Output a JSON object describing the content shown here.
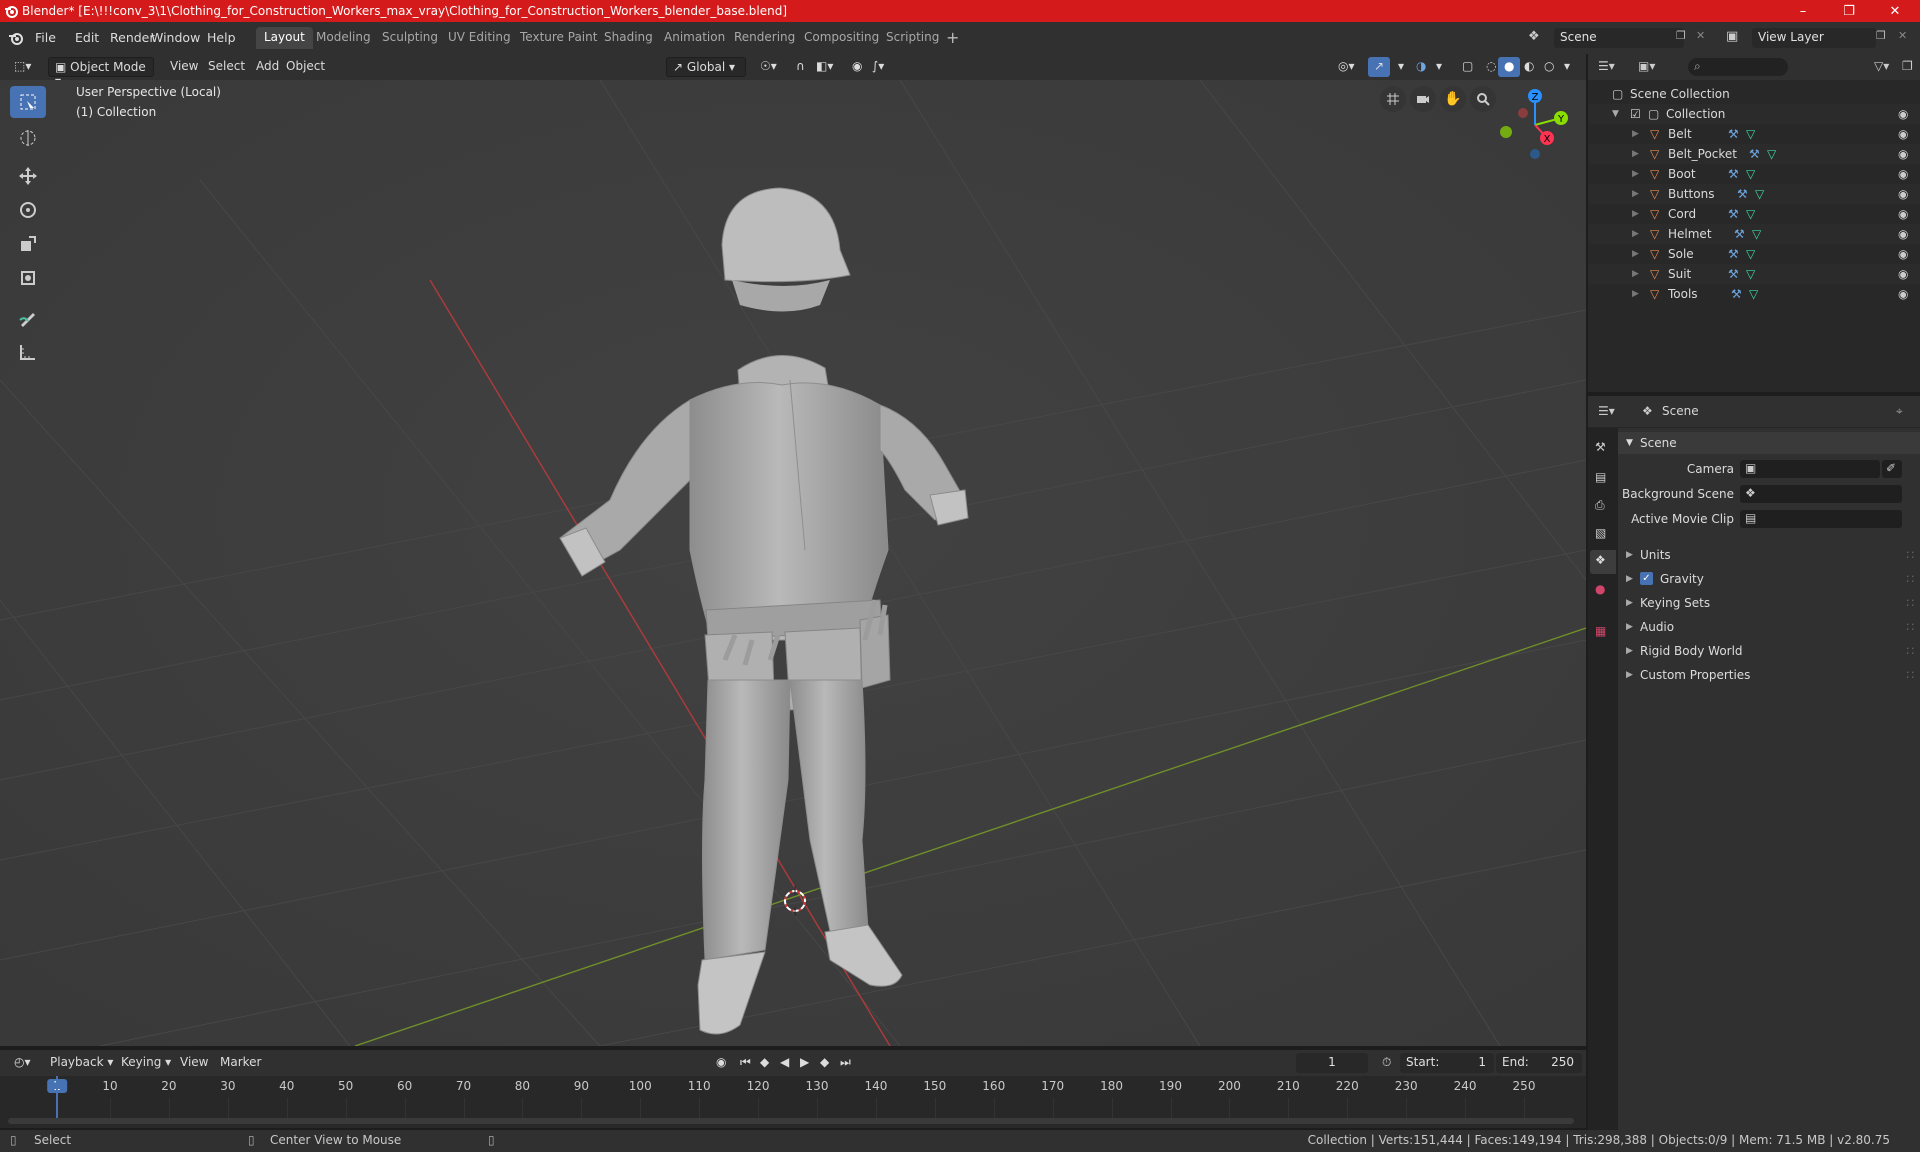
{
  "window": {
    "title": "Blender* [E:\\!!!conv_3\\1\\Clothing_for_Construction_Workers_max_vray\\Clothing_for_Construction_Workers_blender_base.blend]"
  },
  "menu": [
    "File",
    "Edit",
    "Render",
    "Window",
    "Help"
  ],
  "workspaces": [
    "Layout",
    "Modeling",
    "Sculpting",
    "UV Editing",
    "Texture Paint",
    "Shading",
    "Animation",
    "Rendering",
    "Compositing",
    "Scripting"
  ],
  "scene_field": "Scene",
  "view_layer_field": "View Layer",
  "viewport_header": {
    "mode": "Object Mode",
    "view": "View",
    "select": "Select",
    "add": "Add",
    "object": "Object",
    "orientation": "Global"
  },
  "viewport": {
    "info_line1": "User Perspective (Local)",
    "info_line2": "(1) Collection"
  },
  "outliner": {
    "root": "Scene Collection",
    "collection": "Collection",
    "objects": [
      "Belt",
      "Belt_Pocket",
      "Boot",
      "Buttons",
      "Cord",
      "Helmet",
      "Sole",
      "Suit",
      "Tools"
    ]
  },
  "properties": {
    "header_title": "Scene",
    "panel_title": "Scene",
    "camera_label": "Camera",
    "background_scene_label": "Background Scene",
    "active_movie_clip_label": "Active Movie Clip",
    "sections": [
      "Units",
      "Gravity",
      "Keying Sets",
      "Audio",
      "Rigid Body World",
      "Custom Properties"
    ],
    "gravity_checked": true
  },
  "timeline": {
    "playback": "Playback",
    "keying": "Keying",
    "view": "View",
    "marker": "Marker",
    "current_frame": "1",
    "start_label": "Start:",
    "start_value": "1",
    "end_label": "End:",
    "end_value": "250",
    "ruler": [
      "1",
      "10",
      "20",
      "30",
      "40",
      "50",
      "60",
      "70",
      "80",
      "90",
      "100",
      "110",
      "120",
      "130",
      "140",
      "150",
      "160",
      "170",
      "180",
      "190",
      "200",
      "210",
      "220",
      "230",
      "240",
      "250"
    ]
  },
  "status": {
    "select": "Select",
    "center_view": "Center View to Mouse",
    "stats": "Collection | Verts:151,444 | Faces:149,194 | Tris:298,388 | Objects:0/9 | Mem: 71.5 MB | v2.80.75"
  },
  "colors": {
    "titlebar": "#d41a1a",
    "accent": "#4772b3",
    "mesh_icon": "#e5894d",
    "modifier_icon": "#6ea6e0",
    "data_icon": "#3fd6a6",
    "axis_x": "#ff3352",
    "axis_y": "#8bdc00",
    "axis_z": "#2890ff"
  }
}
